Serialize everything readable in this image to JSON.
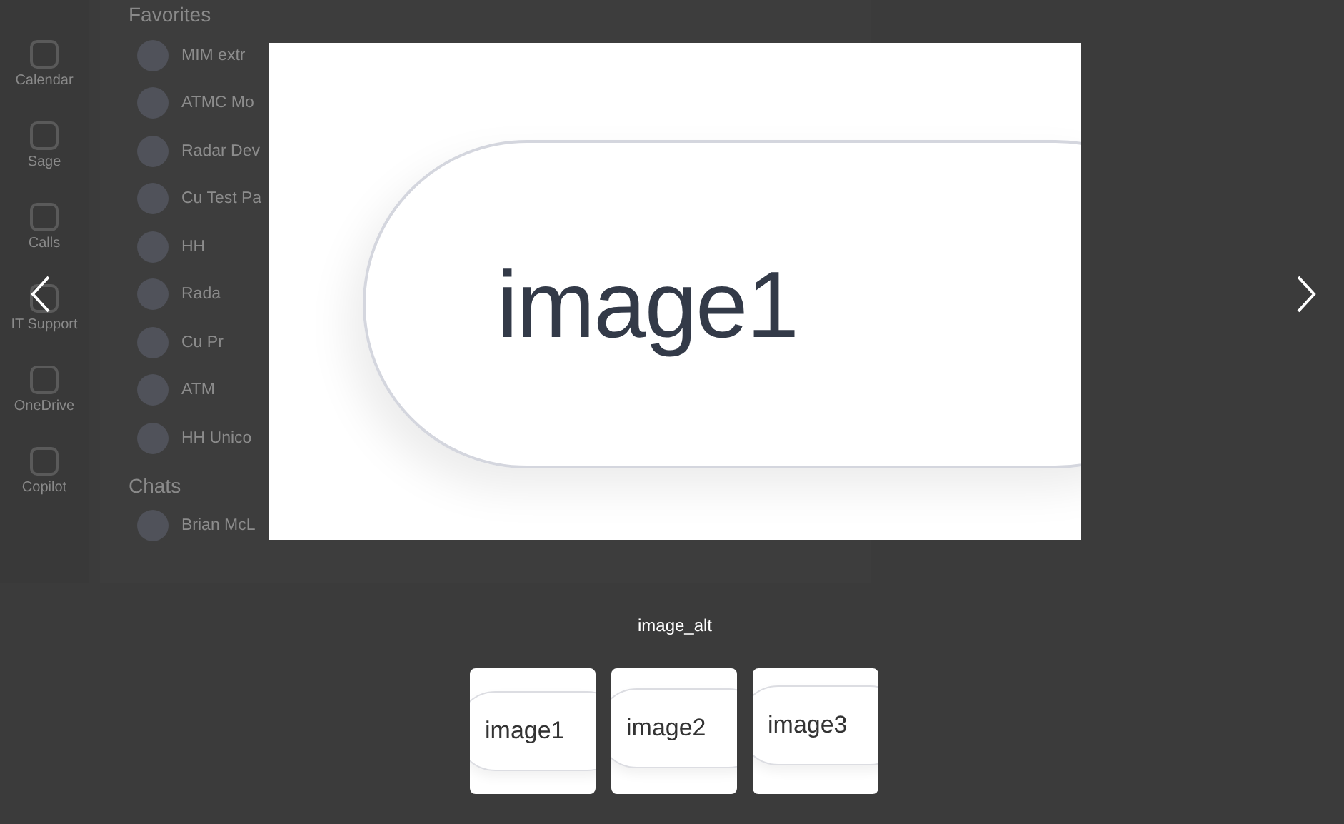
{
  "rail": [
    {
      "label": "Calendar"
    },
    {
      "label": "Sage"
    },
    {
      "label": "Calls"
    },
    {
      "label": "IT Support"
    },
    {
      "label": "OneDrive"
    },
    {
      "label": "Copilot"
    }
  ],
  "favorites": {
    "heading": "Favorites",
    "items": [
      {
        "label": "MIM extr"
      },
      {
        "label": "ATMC Mo"
      },
      {
        "label": "Radar Dev"
      },
      {
        "label": "Cu Test Pa"
      },
      {
        "label": "HH"
      },
      {
        "label": "Rada"
      },
      {
        "label": "Cu Pr"
      },
      {
        "label": "ATM"
      },
      {
        "label": "HH Unico"
      }
    ]
  },
  "chats": {
    "heading": "Chats",
    "items": [
      {
        "label": "Brian McL"
      }
    ]
  },
  "viewer": {
    "image_text": "image1",
    "caption": "image_alt",
    "thumbnails": [
      {
        "label": "image1"
      },
      {
        "label": "image2"
      },
      {
        "label": "image3"
      }
    ]
  }
}
